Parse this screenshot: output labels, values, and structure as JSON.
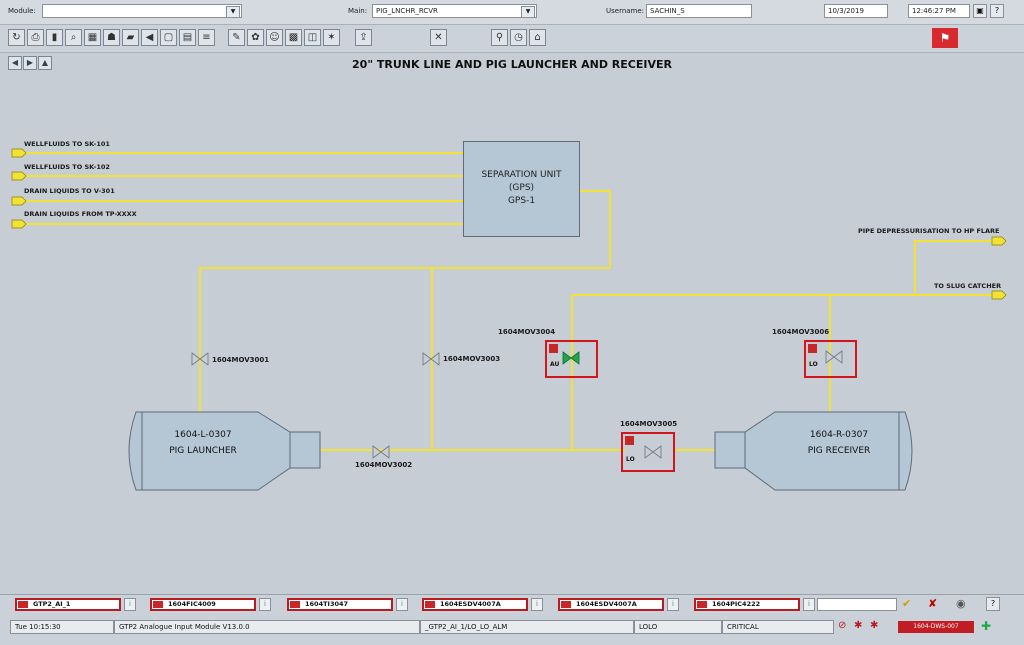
{
  "header": {
    "module_label": "Module:",
    "module_value": "",
    "main_label": "Main:",
    "main_value": "PIG_LNCHR_RCVR",
    "username_label": "Username:",
    "username_value": "SACHIN_S",
    "date": "10/3/2019",
    "time": "12:46:27 PM",
    "help": "?"
  },
  "toolbar": {
    "icons": [
      "open-icon",
      "print-icon",
      "bars-icon",
      "zoom-icon",
      "grid-icon",
      "users-icon",
      "folder-icon",
      "back-icon",
      "window-icon",
      "report-icon",
      "list-icon",
      "notes-icon",
      "palette-icon",
      "people-icon",
      "image-icon",
      "layout-icon",
      "warning-icon",
      "export-icon",
      "tools-icon",
      "search-users-icon",
      "clock-icon",
      "printer-icon"
    ],
    "alarm_icon": "alarm-flag-icon"
  },
  "page": {
    "title": "20\" TRUNK LINE AND PIG LAUNCHER AND RECEIVER"
  },
  "lines": {
    "wf101": "WELLFLUIDS TO SK-101",
    "wf102": "WELLFLUIDS TO SK-102",
    "drain301": "DRAIN LIQUIDS TO V-301",
    "draintp": "DRAIN LIQUIDS FROM TP-XXXX",
    "flare": "PIPE DEPRESSURISATION TO HP FLARE",
    "slug": "TO SLUG CATCHER"
  },
  "separator": {
    "line1": "SEPARATION UNIT",
    "line2": "(GPS)",
    "line3": "GPS-1"
  },
  "launcher": {
    "tag": "1604-L-0307",
    "name": "PIG LAUNCHER"
  },
  "receiver": {
    "tag": "1604-R-0307",
    "name": "PIG RECEIVER"
  },
  "valves": {
    "v3001": "1604MOV3001",
    "v3002": "1604MOV3002",
    "v3003": "1604MOV3003",
    "v3004": "1604MOV3004",
    "v3005": "1604MOV3005",
    "v3006": "1604MOV3006",
    "v3004_mode": "AU",
    "v3005_mode": "LO",
    "v3006_mode": "LO"
  },
  "alarms": [
    {
      "tag": "GTP2_AI_1"
    },
    {
      "tag": "1604FIC4009"
    },
    {
      "tag": "1604TI3047"
    },
    {
      "tag": "1604ESDV4007A"
    },
    {
      "tag": "1604ESDV4007A"
    },
    {
      "tag": "1604PIC4222"
    }
  ],
  "status": {
    "time": "Tue 10:15:30",
    "module": "GTP2 Analogue Input Module V13.0.0",
    "alarm_point": "_GTP2_AI_1/LO_LO_ALM",
    "level": "LOLO",
    "severity": "CRITICAL",
    "indicator": "1604-DWS-007"
  },
  "colors": {
    "process_line": "#f2e233",
    "alarm_red": "#d1161c",
    "vessel_fill": "#b5c6d4"
  }
}
